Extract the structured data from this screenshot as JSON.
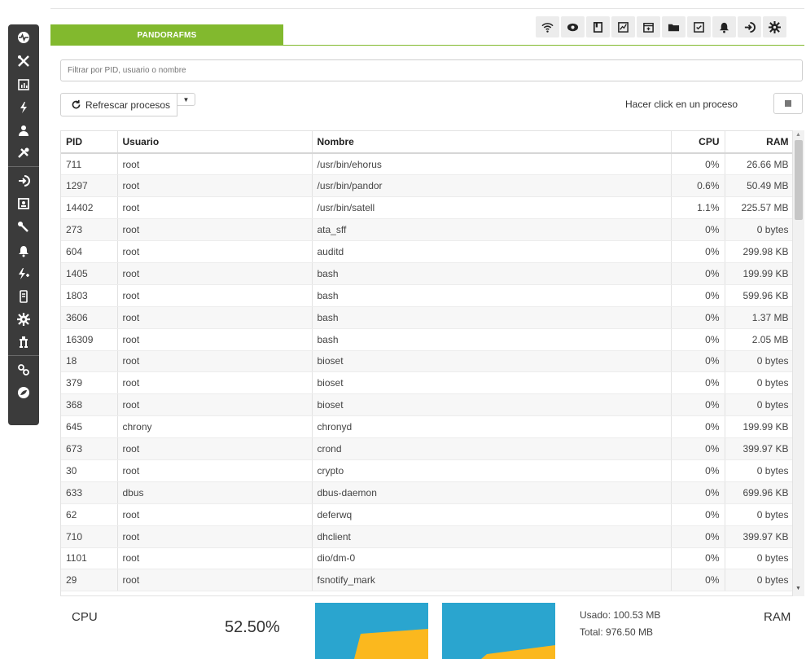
{
  "header": {
    "tab_label": "PANDORAFMS"
  },
  "toolbar": {
    "items": [
      "wifi-icon",
      "eye-icon",
      "bookmark-icon",
      "chart-icon",
      "calendar-icon",
      "folder-icon",
      "checklist-icon",
      "bell-icon",
      "logout-icon",
      "gear-icon"
    ]
  },
  "sidebar": {
    "items": [
      "pulse-icon",
      "tools-cross-icon",
      "bar-chart-icon",
      "lightning-icon",
      "user-icon",
      "wrench-screwdriver-icon",
      "logout-icon",
      "contact-card-icon",
      "wrench-icon",
      "bell-icon",
      "lightning-plus-icon",
      "server-icon",
      "gear-icon",
      "network-icon",
      "link-icon",
      "circle-logo-icon"
    ]
  },
  "filter": {
    "placeholder": "Filtrar por PID, usuario o nombre"
  },
  "actions": {
    "refresh_label": "Refrescar procesos",
    "hint": "Hacer click en un proceso"
  },
  "table": {
    "columns": {
      "pid": "PID",
      "user": "Usuario",
      "name": "Nombre",
      "cpu": "CPU",
      "ram": "RAM"
    },
    "rows": [
      [
        "711",
        "root",
        "/usr/bin/ehorus",
        "0%",
        "26.66 MB"
      ],
      [
        "1297",
        "root",
        "/usr/bin/pandor",
        "0.6%",
        "50.49 MB"
      ],
      [
        "14402",
        "root",
        "/usr/bin/satell",
        "1.1%",
        "225.57 MB"
      ],
      [
        "273",
        "root",
        "ata_sff",
        "0%",
        "0 bytes"
      ],
      [
        "604",
        "root",
        "auditd",
        "0%",
        "299.98 KB"
      ],
      [
        "1405",
        "root",
        "bash",
        "0%",
        "199.99 KB"
      ],
      [
        "1803",
        "root",
        "bash",
        "0%",
        "599.96 KB"
      ],
      [
        "3606",
        "root",
        "bash",
        "0%",
        "1.37 MB"
      ],
      [
        "16309",
        "root",
        "bash",
        "0%",
        "2.05 MB"
      ],
      [
        "18",
        "root",
        "bioset",
        "0%",
        "0 bytes"
      ],
      [
        "379",
        "root",
        "bioset",
        "0%",
        "0 bytes"
      ],
      [
        "368",
        "root",
        "bioset",
        "0%",
        "0 bytes"
      ],
      [
        "645",
        "chrony",
        "chronyd",
        "0%",
        "199.99 KB"
      ],
      [
        "673",
        "root",
        "crond",
        "0%",
        "399.97 KB"
      ],
      [
        "30",
        "root",
        "crypto",
        "0%",
        "0 bytes"
      ],
      [
        "633",
        "dbus",
        "dbus-daemon",
        "0%",
        "699.96 KB"
      ],
      [
        "62",
        "root",
        "deferwq",
        "0%",
        "0 bytes"
      ],
      [
        "710",
        "root",
        "dhclient",
        "0%",
        "399.97 KB"
      ],
      [
        "1101",
        "root",
        "dio/dm-0",
        "0%",
        "0 bytes"
      ],
      [
        "29",
        "root",
        "fsnotify_mark",
        "0%",
        "0 bytes"
      ]
    ]
  },
  "footer": {
    "cpu_label": "CPU",
    "cpu_value": "52.50%",
    "ram_used": "Usado: 100.53 MB",
    "ram_total": "Total: 976.50 MB",
    "ram_label": "RAM"
  },
  "colors": {
    "accent_green": "#82b92e",
    "gauge_blue": "#2aa5cf",
    "gauge_yellow": "#fbb81e",
    "sidebar_bg": "#3b3b3b"
  }
}
